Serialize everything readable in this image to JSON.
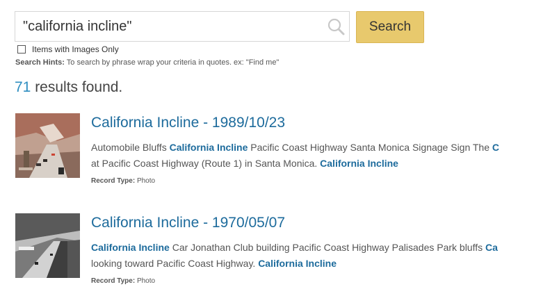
{
  "search": {
    "value": "\"california incline\"",
    "button_label": "Search",
    "images_only_label": "Items with Images Only",
    "hints_label": "Search Hints:",
    "hints_text": " To search by phrase wrap your criteria in quotes. ex: \"Find me\""
  },
  "results": {
    "count": "71",
    "count_suffix": " results found.",
    "record_type_label": "Record Type:",
    "items": [
      {
        "title": "California Incline - 1989/10/23",
        "line1": [
          {
            "t": "Automobile Bluffs ",
            "hl": false
          },
          {
            "t": "California Incline",
            "hl": true
          },
          {
            "t": " Pacific Coast Highway Santa Monica Signage Sign The ",
            "hl": false
          },
          {
            "t": "C",
            "hl": true
          }
        ],
        "line2": [
          {
            "t": "at Pacific Coast Highway (Route 1) in Santa Monica. ",
            "hl": false
          },
          {
            "t": "California Incline",
            "hl": true
          }
        ],
        "record_type": "Photo",
        "thumb_icon": "color-photo-highway-bluffs"
      },
      {
        "title": "California Incline - 1970/05/07",
        "line1": [
          {
            "t": "California Incline",
            "hl": true
          },
          {
            "t": " Car Jonathan Club building Pacific Coast Highway Palisades Park bluffs ",
            "hl": false
          },
          {
            "t": "Ca",
            "hl": true
          }
        ],
        "line2": [
          {
            "t": "looking toward Pacific Coast Highway. ",
            "hl": false
          },
          {
            "t": "California Incline",
            "hl": true
          }
        ],
        "record_type": "Photo",
        "thumb_icon": "bw-photo-coastal-highway"
      }
    ]
  }
}
